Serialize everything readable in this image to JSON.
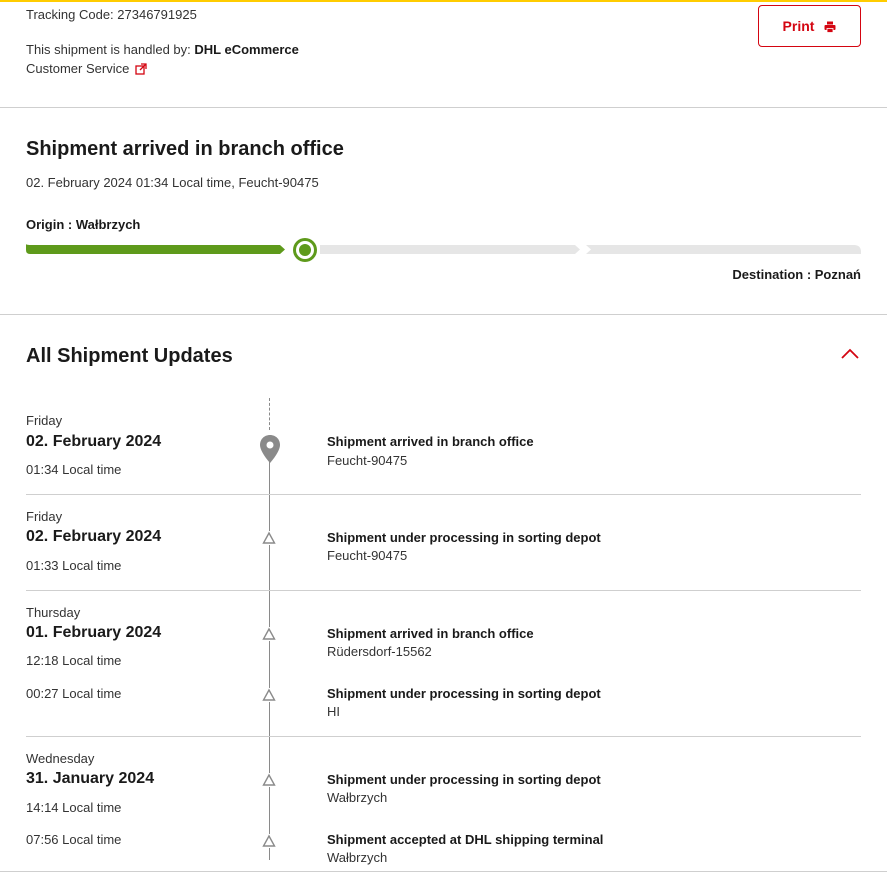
{
  "header": {
    "tracking_label": "Tracking Code: ",
    "tracking_code": "27346791925",
    "handled_by_label": "This shipment is handled by: ",
    "handled_by_company": "DHL eCommerce",
    "customer_service_label": "Customer Service",
    "print_label": "Print"
  },
  "status": {
    "title": "Shipment arrived in branch office",
    "subtitle": "02. February 2024 01:34 Local time, Feucht-90475",
    "origin_label": "Origin : ",
    "origin_value": "Wałbrzych",
    "destination_label": "Destination : ",
    "destination_value": "Poznań",
    "progress_fraction": 0.33
  },
  "updates": {
    "title": "All Shipment Updates",
    "groups": [
      {
        "day": "Friday",
        "date": "02. February 2024",
        "events": [
          {
            "time": "01:34 Local time",
            "title": "Shipment arrived in branch office",
            "location": "Feucht-90475",
            "icon": "location-pin-icon"
          }
        ]
      },
      {
        "day": "Friday",
        "date": "02. February 2024",
        "events": [
          {
            "time": "01:33 Local time",
            "title": "Shipment under processing in sorting depot",
            "location": "Feucht-90475",
            "icon": "triangle-icon"
          }
        ]
      },
      {
        "day": "Thursday",
        "date": "01. February 2024",
        "events": [
          {
            "time": "12:18 Local time",
            "title": "Shipment arrived in branch office",
            "location": "Rüdersdorf-15562",
            "icon": "triangle-icon"
          },
          {
            "time": "00:27 Local time",
            "title": "Shipment under processing in sorting depot",
            "location": "HI",
            "icon": "triangle-icon"
          }
        ]
      },
      {
        "day": "Wednesday",
        "date": "31. January 2024",
        "events": [
          {
            "time": "14:14 Local time",
            "title": "Shipment under processing in sorting depot",
            "location": "Wałbrzych",
            "icon": "triangle-icon"
          },
          {
            "time": "07:56 Local time",
            "title": "Shipment accepted at DHL shipping terminal",
            "location": "Wałbrzych",
            "icon": "triangle-icon"
          }
        ]
      }
    ]
  },
  "colors": {
    "brand_red": "#d40511",
    "brand_yellow": "#ffcc00",
    "progress_green": "#5e9a1b",
    "progress_track": "#e6e6e6"
  }
}
